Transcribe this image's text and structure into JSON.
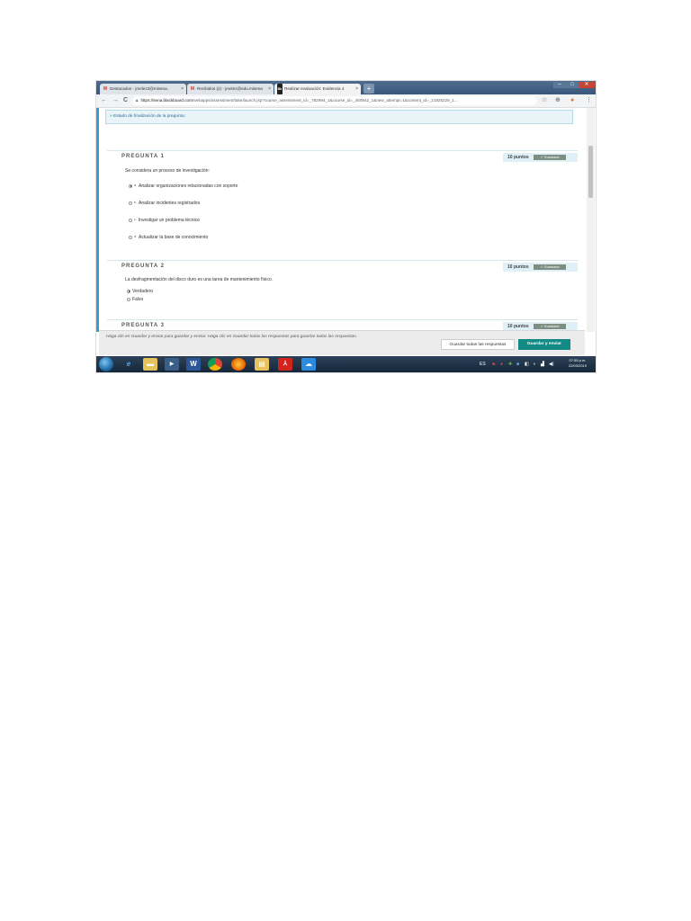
{
  "browser": {
    "tabs": [
      {
        "icon": "gmail-icon",
        "label": "Destacados - jmelez3@misena.",
        "close": "×"
      },
      {
        "icon": "gmail-icon",
        "label": "Recibidos (2) - jmelez@edu.misena",
        "close": "×"
      },
      {
        "icon": "blackboard-icon",
        "label": "Realizar evaluación: Evidencia 4",
        "close": "×"
      }
    ],
    "new_tab": "+",
    "window_controls": {
      "minimize": "–",
      "maximize": "□",
      "close": "✕"
    },
    "nav": {
      "back": "←",
      "forward": "→",
      "reload": "C"
    },
    "url_host": "https://sena.blackboard.com",
    "url_path": "/webapps/assessment/take/launch.jsp?course_assessment_id=_782994_1&course_id=_460842_1&new_attempt=1&content_id=_21925229_1...",
    "ext_icons": {
      "star": "☆",
      "ext1": "⊕",
      "more": "⋮"
    }
  },
  "page": {
    "status_link": "» Estado de finalización de la pregunta:",
    "questions": [
      {
        "title": "PREGUNTA 1",
        "points": "10 puntos",
        "saved": "✓ Guardado",
        "text": "Se considera un proceso de investigación:",
        "options": [
          {
            "letter": "a.",
            "label": "Analizar organizaciones relacionadas con soporte",
            "selected": true
          },
          {
            "letter": "b.",
            "label": "Analizar incidentes registrados",
            "selected": false
          },
          {
            "letter": "c.",
            "label": "Investigar un problema técnico",
            "selected": false
          },
          {
            "letter": "d.",
            "label": "Actualizar la base de conocimiento",
            "selected": false
          }
        ]
      },
      {
        "title": "PREGUNTA 2",
        "points": "10 puntos",
        "saved": "✓ Guardado",
        "text": "La desfragmentación del disco duro es una tarea de mantenimiento físico.",
        "options": [
          {
            "letter": "",
            "label": "Verdadero",
            "selected": true
          },
          {
            "letter": "",
            "label": "Falso",
            "selected": false
          }
        ]
      },
      {
        "title": "PREGUNTA 3",
        "points": "10 puntos",
        "saved": "✓ Guardado"
      }
    ],
    "footer_hint": "Haga clic en Guardar y enviar para guardar y enviar. Haga clic en Guardar todas las respuestas para guardar todas las respuestas.",
    "save_all": "Guardar todas las respuestas",
    "save_submit": "Guardar y enviar"
  },
  "taskbar": {
    "clock_time": "07:55 p.m.",
    "clock_date": "22/03/2019",
    "tray_label": "ES"
  },
  "colors": {
    "accent": "#138a84",
    "leftbar": "#3a9cc9",
    "taskbar": "#1f3147"
  }
}
